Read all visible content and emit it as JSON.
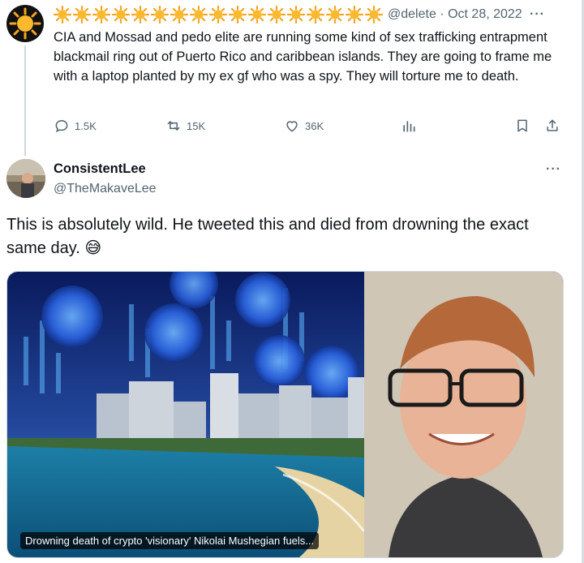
{
  "parent_tweet": {
    "handle": "@delete",
    "separator": "·",
    "date": "Oct 28, 2022",
    "more_label": "···",
    "text": "CIA and Mossad and pedo elite are running some kind of sex trafficking entrapment blackmail ring out of Puerto Rico and caribbean islands. They are going to frame me with a laptop planted by my ex gf who was a spy. They will torture me to death.",
    "stats": {
      "replies": "1.5K",
      "reposts": "15K",
      "likes": "36K"
    },
    "icons": [
      "sun-emoji",
      "reply-icon",
      "repost-icon",
      "like-icon",
      "views-icon",
      "bookmark-icon",
      "share-icon"
    ]
  },
  "reply_tweet": {
    "display_name": "ConsistentLee",
    "handle": "@TheMakaveLee",
    "more_label": "···",
    "text": "This is absolutely wild. He tweeted this and died from drowning the exact same day.",
    "emoji": "😅",
    "media_caption": "Drowning death of crypto 'visionary' Nikolai Mushegian fuels..."
  },
  "colors": {
    "text_primary": "#0f1419",
    "text_secondary": "#536471",
    "border": "#cfd9de"
  }
}
